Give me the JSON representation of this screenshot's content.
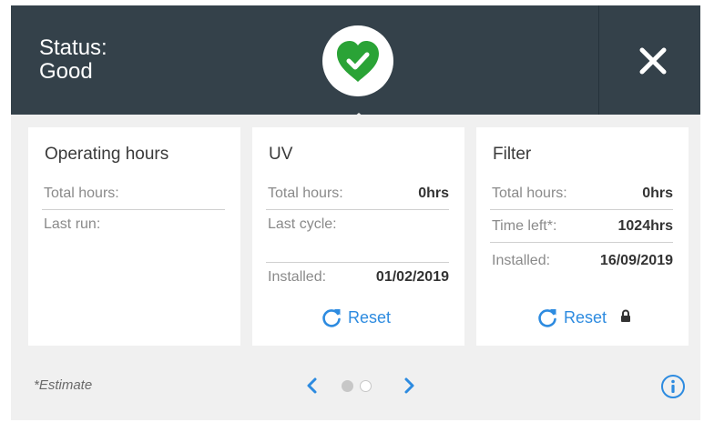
{
  "header": {
    "status_label": "Status:",
    "status_value": "Good",
    "status_icon": "heart-check-icon",
    "close_icon": "close-icon"
  },
  "cards": {
    "operating": {
      "title": "Operating hours",
      "total_label": "Total hours:",
      "last_run_label": "Last run:"
    },
    "uv": {
      "title": "UV",
      "total_label": "Total hours:",
      "total_value": "0hrs",
      "last_cycle_label": "Last cycle:",
      "installed_label": "Installed:",
      "installed_value": "01/02/2019",
      "reset_label": "Reset"
    },
    "filter": {
      "title": "Filter",
      "total_label": "Total hours:",
      "total_value": "0hrs",
      "time_left_label": "Time left*:",
      "time_left_value": "1024hrs",
      "installed_label": "Installed:",
      "installed_value": "16/09/2019",
      "reset_label": "Reset"
    }
  },
  "footer": {
    "footnote": "*Estimate",
    "page_current": 1,
    "page_count": 2
  },
  "colors": {
    "header_bg": "#34414a",
    "accent_blue": "#2d8be0",
    "status_green": "#2aa336",
    "panel_bg": "#f0f0f0"
  }
}
